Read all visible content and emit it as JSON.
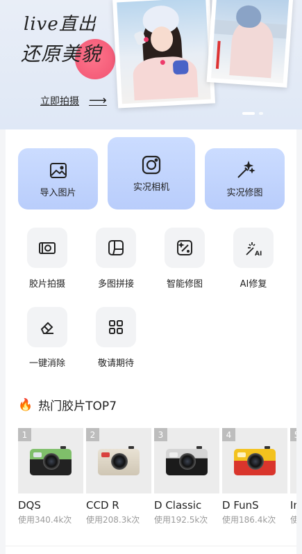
{
  "banner": {
    "script_line1": "live直出",
    "script_line2": "还原美貌",
    "cta_label": "立即拍摄",
    "cta_arrow": "⟶"
  },
  "main_buttons": [
    {
      "label": "导入图片",
      "icon": "image-icon"
    },
    {
      "label": "实况相机",
      "icon": "camera-icon"
    },
    {
      "label": "实况修图",
      "icon": "magic-wand-icon"
    }
  ],
  "tools": [
    {
      "label": "胶片拍摄",
      "icon": "film-camera-icon"
    },
    {
      "label": "多图拼接",
      "icon": "collage-icon"
    },
    {
      "label": "智能修图",
      "icon": "smart-edit-icon"
    },
    {
      "label": "AI修复",
      "icon": "ai-repair-icon"
    },
    {
      "label": "一键消除",
      "icon": "eraser-icon"
    },
    {
      "label": "敬请期待",
      "icon": "grid-icon"
    }
  ],
  "section": {
    "title": "热门胶片TOP7",
    "icon": "fire-icon"
  },
  "films": [
    {
      "rank": "1",
      "name": "DQS",
      "usage": "使用340.4k次"
    },
    {
      "rank": "2",
      "name": "CCD R",
      "usage": "使用208.3k次"
    },
    {
      "rank": "3",
      "name": "D Classic",
      "usage": "使用192.5k次"
    },
    {
      "rank": "4",
      "name": "D FunS",
      "usage": "使用186.4k次"
    },
    {
      "rank": "5",
      "name": "In",
      "usage": "使"
    }
  ],
  "colors": {
    "accent_button": "#c4d6fd",
    "banner_bg": "#e4ebf6",
    "pink_dot": "#f25d78"
  }
}
